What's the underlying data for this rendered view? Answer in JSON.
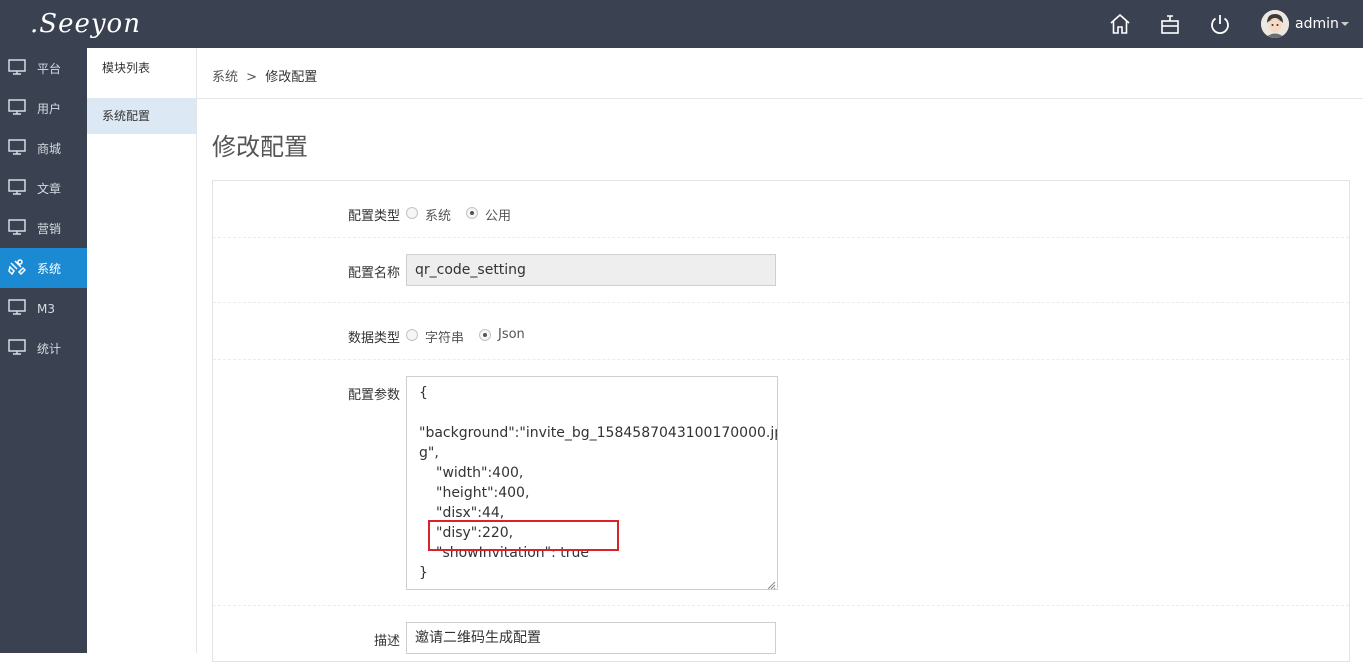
{
  "header": {
    "logo_text": ".Seeyon",
    "icons": [
      "home-icon",
      "shop-icon",
      "power-icon"
    ],
    "user_name": "admin"
  },
  "sidebar": {
    "items": [
      {
        "label": "平台",
        "icon": "monitor-icon",
        "active": false
      },
      {
        "label": "用户",
        "icon": "monitor-icon",
        "active": false
      },
      {
        "label": "商城",
        "icon": "monitor-icon",
        "active": false
      },
      {
        "label": "文章",
        "icon": "monitor-icon",
        "active": false
      },
      {
        "label": "营销",
        "icon": "monitor-icon",
        "active": false
      },
      {
        "label": "系统",
        "icon": "settings-icon",
        "active": true
      },
      {
        "label": "M3",
        "icon": "monitor-icon",
        "active": false
      },
      {
        "label": "统计",
        "icon": "monitor-icon",
        "active": false
      }
    ]
  },
  "submenu": {
    "items": [
      {
        "label": "模块列表",
        "active": false
      },
      {
        "label": "系统配置",
        "active": true
      }
    ]
  },
  "breadcrumb": {
    "parent": "系统",
    "separator": ">",
    "current": "修改配置"
  },
  "page": {
    "title": "修改配置"
  },
  "form": {
    "config_type": {
      "label": "配置类型",
      "options": [
        "系统",
        "公用"
      ],
      "selected": "公用"
    },
    "config_name": {
      "label": "配置名称",
      "value": "qr_code_setting"
    },
    "data_type": {
      "label": "数据类型",
      "options": [
        "字符串",
        "Json"
      ],
      "selected": "Json"
    },
    "config_params": {
      "label": "配置参数",
      "lines": [
        "{",
        "",
        "\"background\":\"invite_bg_1584587043100170000.jp",
        "g\",",
        "\"width\":400,",
        "\"height\":400,",
        "\"disx\":44,",
        "\"disy\":220,",
        "\"showInvitation\": true",
        "}"
      ]
    },
    "description": {
      "label": "描述",
      "value": "邀请二维码生成配置"
    }
  },
  "colors": {
    "header_bg": "#3a4150",
    "sidebar_active": "#1b8ad3",
    "submenu_active": "#dce8f4",
    "highlight": "#d9232c"
  }
}
